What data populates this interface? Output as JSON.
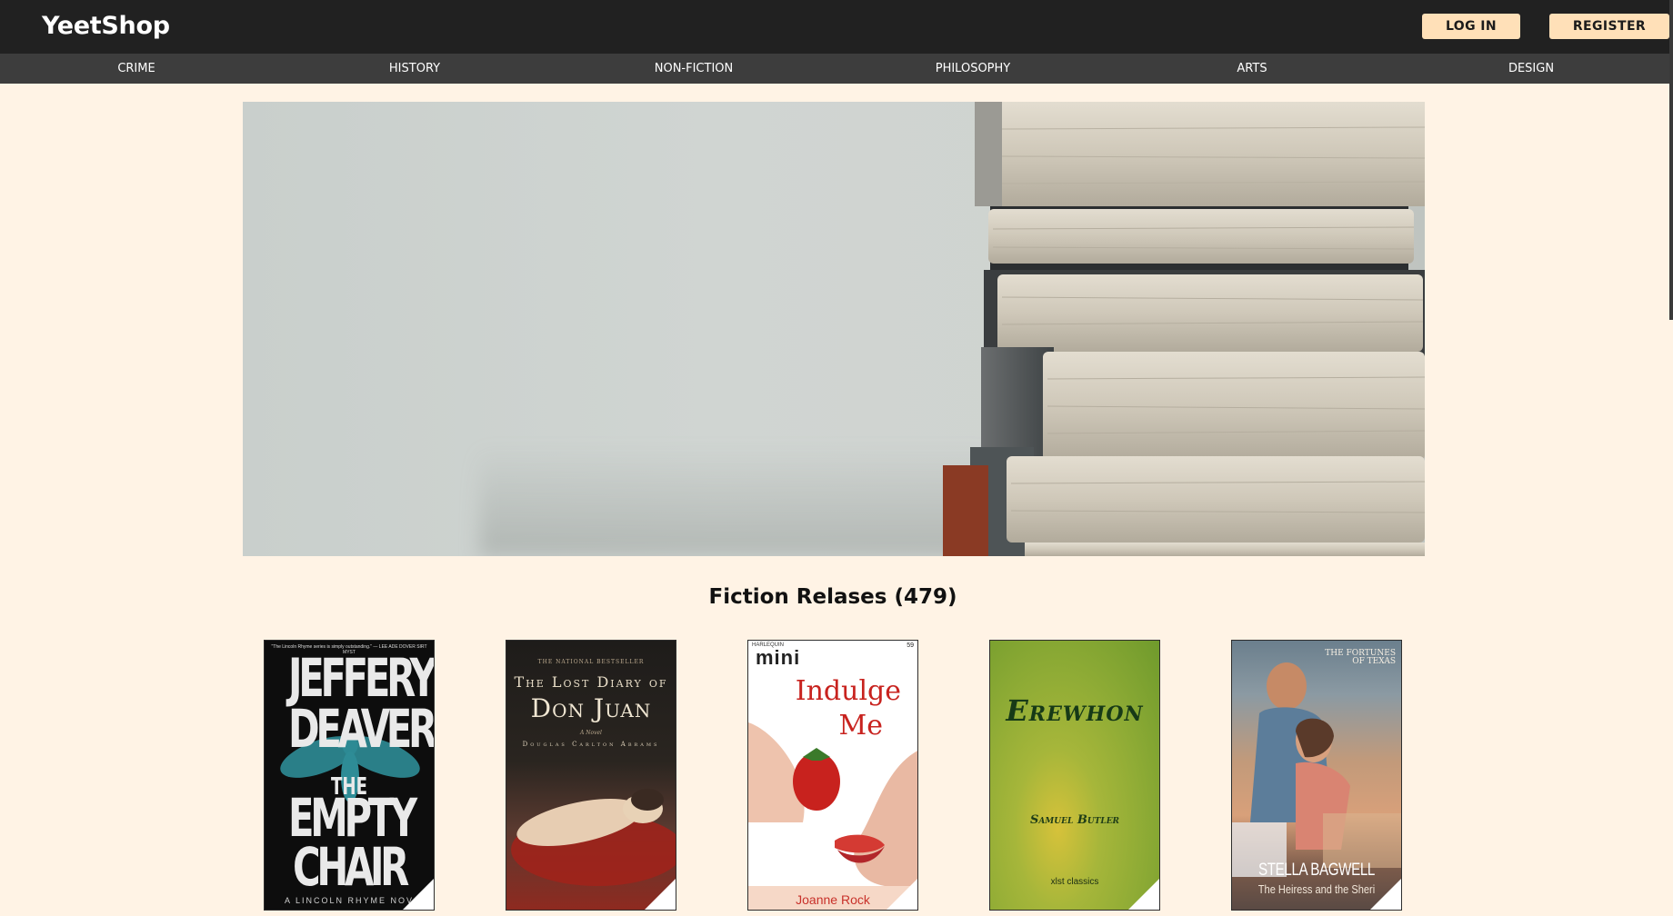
{
  "header": {
    "logo": "YeetShop",
    "login_label": "LOG IN",
    "register_label": "REGISTER"
  },
  "categories": [
    "CRIME",
    "HISTORY",
    "NON-FICTION",
    "PHILOSOPHY",
    "ARTS",
    "DESIGN"
  ],
  "section": {
    "title": "Fiction Relases (479)"
  },
  "books": [
    {
      "top_note": "\"The Lincoln Rhyme series is simply outstanding.\" — LEE ADE DOVER SIRT MYST",
      "line1": "JEFFERY",
      "line2": "DEAVER",
      "line3": "THE",
      "line4": "EMPTY",
      "line5": "CHAIR",
      "bottom": "A LINCOLN RHYME NOV"
    },
    {
      "top_note": "THE NATIONAL BESTSELLER",
      "line1": "The Lost Diary of",
      "line2": "Don Juan",
      "line3": "A Novel",
      "line4": "Douglas Carlton Abrams"
    },
    {
      "brand": "HARLEQUIN",
      "series": "mini",
      "number": "59",
      "line1": "Indulge",
      "line2": "Me",
      "author": "Joanne Rock"
    },
    {
      "title": "Erewhon",
      "author": "Samuel Butler",
      "publisher": "xlst classics"
    },
    {
      "series_top": "THE FORTUNES OF TEXAS",
      "author": "STELLA BAGWELL",
      "subtitle": "The Heiress and the Sheri"
    }
  ],
  "colors": {
    "page_bg": "#fff3e5",
    "topbar_bg": "#212121",
    "catbar_bg": "#3d3d3d",
    "button_bg": "#ffe0b8"
  }
}
